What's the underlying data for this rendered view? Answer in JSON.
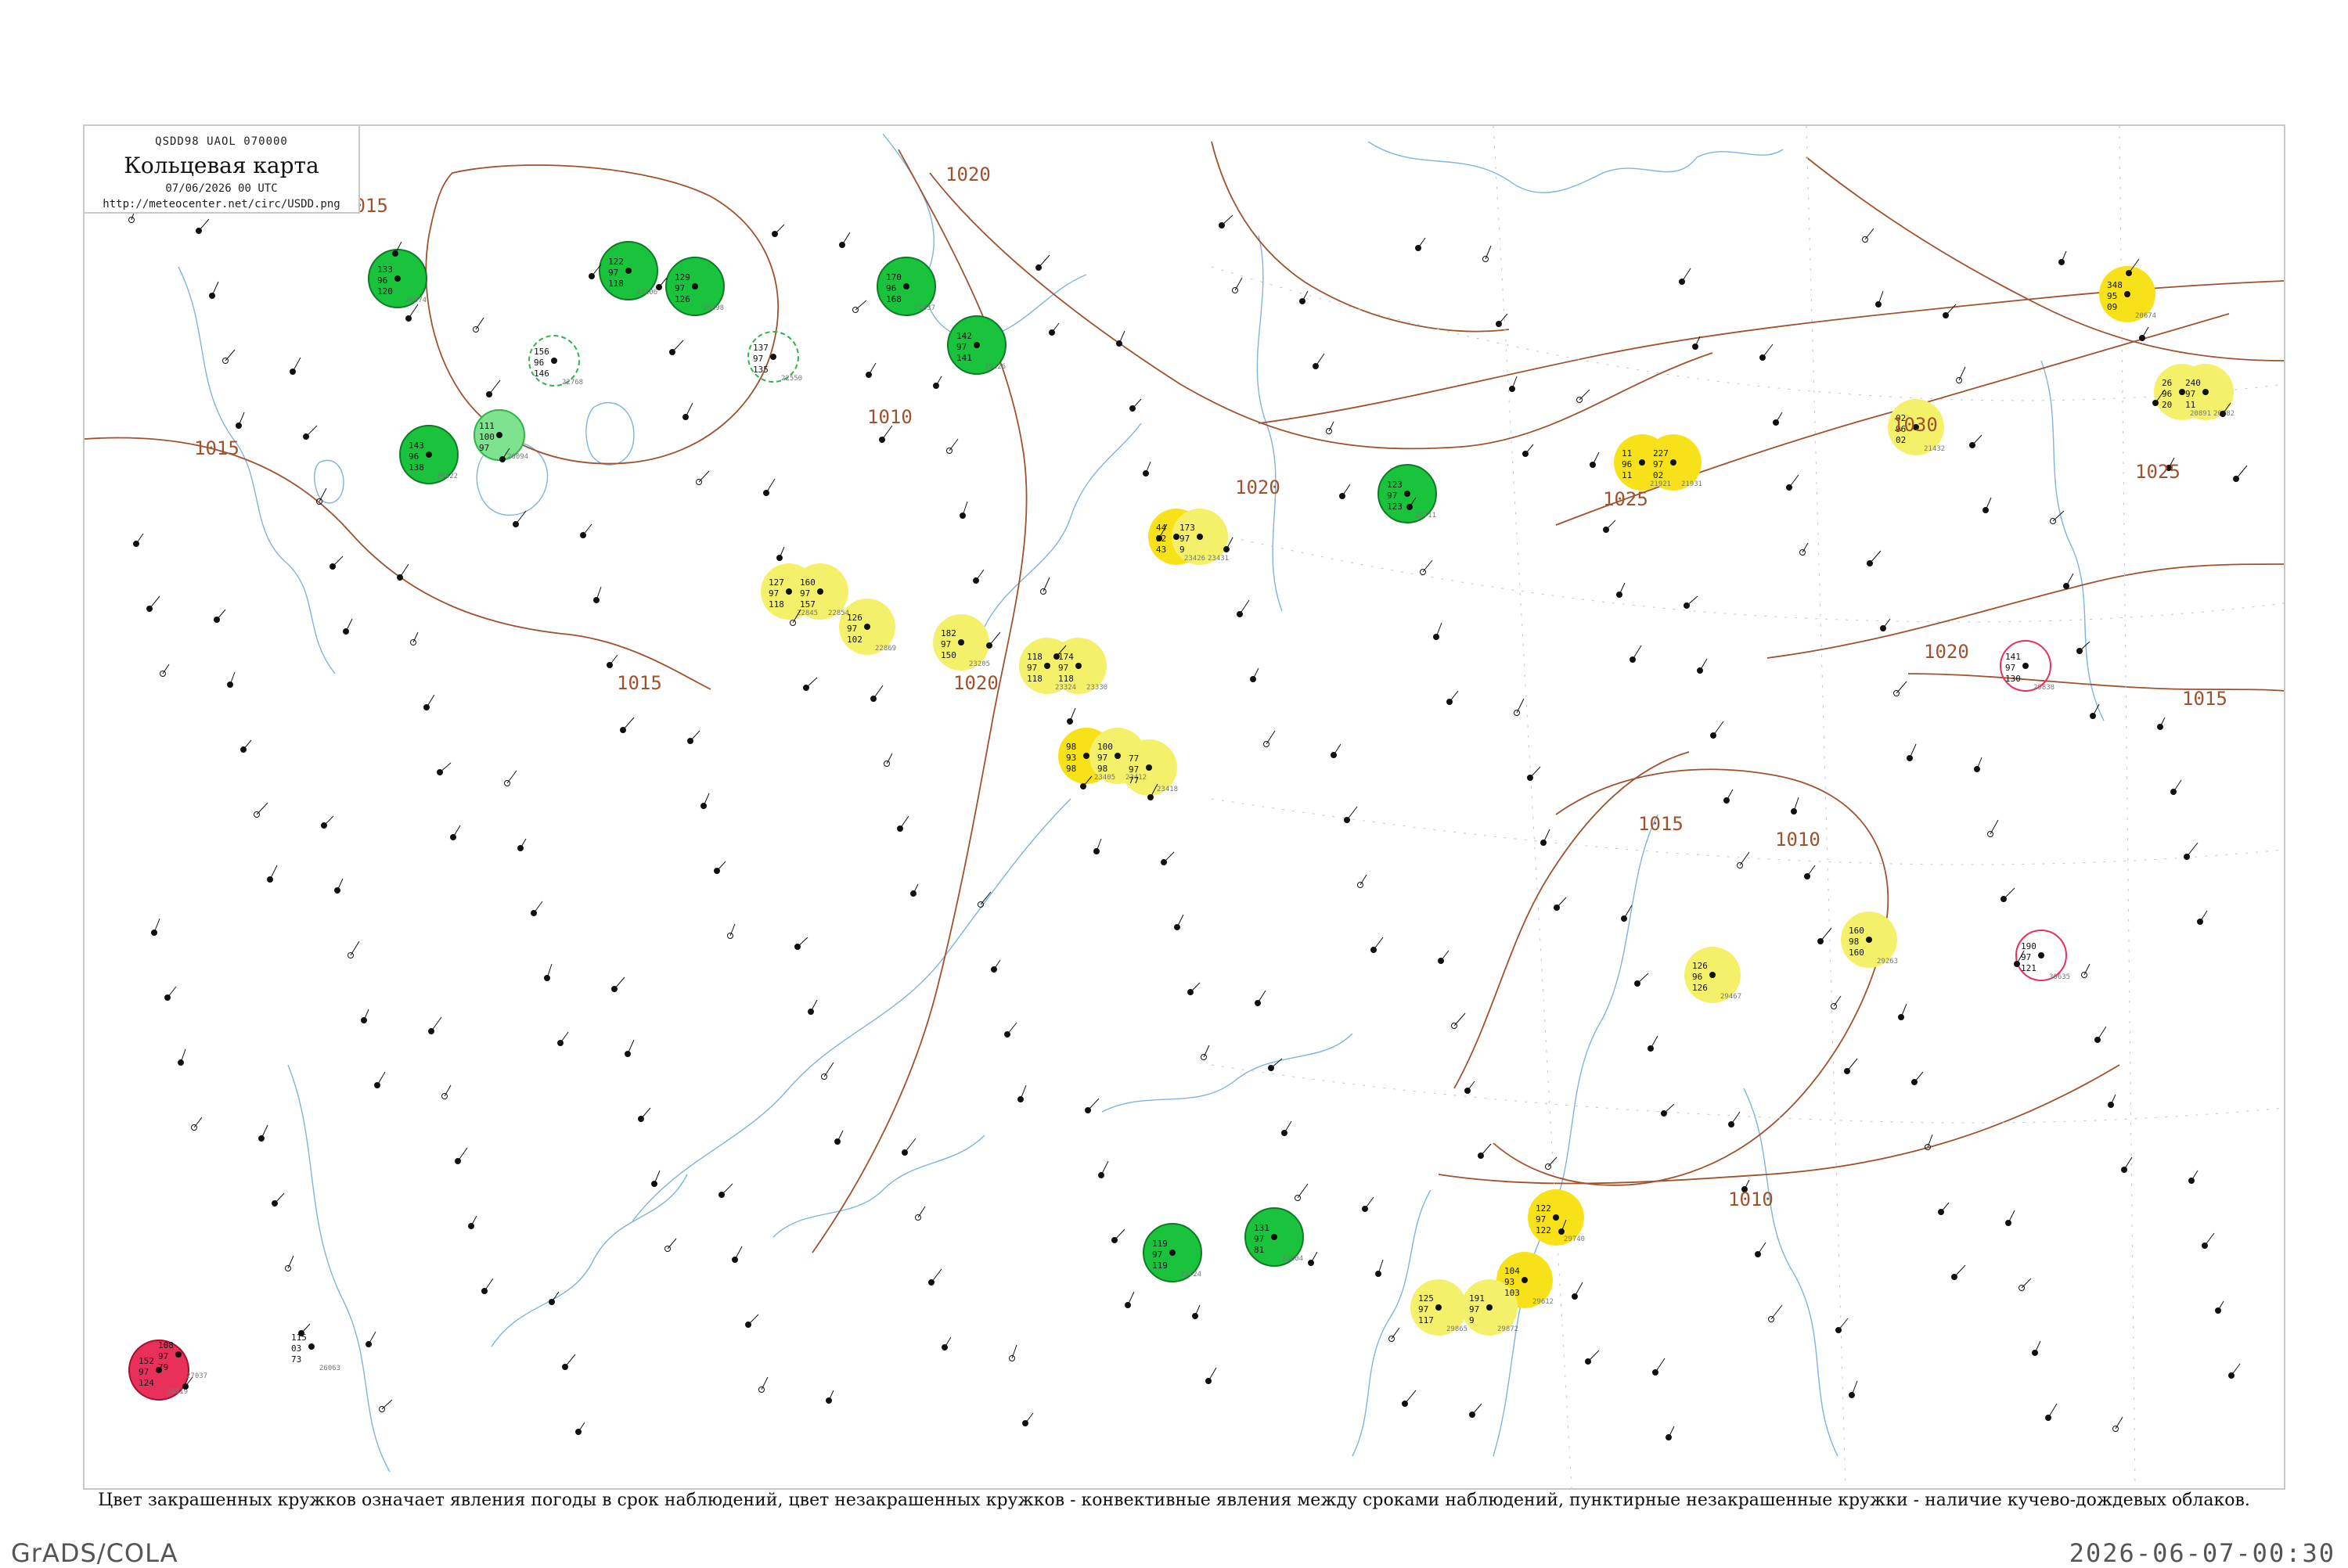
{
  "header": {
    "code": "QSDD98  UAOL  070000",
    "title": "Кольцевая карта",
    "date": "07/06/2026 00 UTC",
    "url": "http://meteocenter.net/circ/USDD.png"
  },
  "caption": "Цвет закрашенных кружков означает явления погоды в срок наблюдений, цвет незакрашенных кружков - конвективные явления между сроками наблюдений, пунктирные незакрашенные кружки - наличие кучево-дождевых облаков.",
  "footer": {
    "left": "GrADS/COLA",
    "right": "2026-06-07-00:30"
  },
  "colors": {
    "rain": "#19c43c",
    "drizzle": "#7ee38f",
    "shower_ring": "#2fb34a",
    "haze": "#f5f06a",
    "haze_strong": "#f7e21a",
    "thunder": "#e8305a",
    "isobar": "#a0522d",
    "river": "#7fb3e0",
    "border": "#c8c8c8"
  },
  "isobar_labels": [
    "1015",
    "1015",
    "1020",
    "1020",
    "1020",
    "1020",
    "1025",
    "1030",
    "1025",
    "1015",
    "1015",
    "1010",
    "1010",
    "1010",
    "1015"
  ],
  "stations": [
    {
      "t": "108",
      "p": "97",
      "d": "79",
      "id": "27037",
      "mark": "none"
    },
    {
      "t": "115",
      "p": "03",
      "d": "73",
      "id": "26063",
      "mark": "none"
    },
    {
      "t": "133",
      "p": "96",
      "d": "120",
      "id": "26074",
      "mark": "rain"
    },
    {
      "t": "111",
      "p": "100",
      "d": "97",
      "id": "26094",
      "mark": "drizzle"
    },
    {
      "t": "122",
      "p": "97",
      "d": "118",
      "id": "27106",
      "mark": "rain"
    },
    {
      "t": "129",
      "p": "97",
      "d": "126",
      "id": "26298",
      "mark": "rain"
    },
    {
      "t": "143",
      "p": "96",
      "d": "138",
      "id": "26422",
      "mark": "rain"
    },
    {
      "t": "137",
      "p": "97",
      "d": "135",
      "id": "22550",
      "mark": "ring"
    },
    {
      "t": "156",
      "p": "96",
      "d": "146",
      "id": "22768",
      "mark": "ring"
    },
    {
      "t": "170",
      "p": "96",
      "d": "168",
      "id": "22837",
      "mark": "rain"
    },
    {
      "t": "127",
      "p": "97",
      "d": "118",
      "id": "22845",
      "mark": "haze"
    },
    {
      "t": "160",
      "p": "97",
      "d": "157",
      "id": "22854",
      "mark": "haze"
    },
    {
      "t": "126",
      "p": "97",
      "d": "102",
      "id": "22869",
      "mark": "haze"
    },
    {
      "t": "182",
      "p": "97",
      "d": "150",
      "id": "23205",
      "mark": "haze"
    },
    {
      "t": "142",
      "p": "97",
      "d": "141",
      "id": "23226",
      "mark": "rain"
    },
    {
      "t": "118",
      "p": "97",
      "d": "118",
      "id": "23324",
      "mark": "haze"
    },
    {
      "t": "174",
      "p": "97",
      "d": "118",
      "id": "23330",
      "mark": "haze"
    },
    {
      "t": "98",
      "p": "93",
      "d": "98",
      "id": "23405",
      "mark": "haze_strong"
    },
    {
      "t": "100",
      "p": "97",
      "d": "98",
      "id": "23412",
      "mark": "haze"
    },
    {
      "t": "77",
      "p": "97",
      "d": "77",
      "id": "23418",
      "mark": "haze"
    },
    {
      "t": "44",
      "p": "92",
      "d": "43",
      "id": "23426",
      "mark": "haze_strong"
    },
    {
      "t": "173",
      "p": "97",
      "d": "9",
      "id": "23431",
      "mark": "haze"
    },
    {
      "t": "119",
      "p": "97",
      "d": "119",
      "id": "23724",
      "mark": "rain"
    },
    {
      "t": "131",
      "p": "97",
      "d": "81",
      "id": "23804",
      "mark": "rain"
    },
    {
      "t": "123",
      "p": "97",
      "d": "123",
      "id": "23711",
      "mark": "rain"
    },
    {
      "t": "348",
      "p": "95",
      "d": "09",
      "id": "20674",
      "mark": "haze_strong"
    },
    {
      "t": "26",
      "p": "96",
      "d": "20",
      "id": "20891",
      "mark": "haze"
    },
    {
      "t": "240",
      "p": "97",
      "d": "11",
      "id": "20982",
      "mark": "haze"
    },
    {
      "t": "02",
      "p": "96",
      "d": "02",
      "id": "21432",
      "mark": "haze"
    },
    {
      "t": "11",
      "p": "96",
      "d": "11",
      "id": "21921",
      "mark": "haze_strong"
    },
    {
      "t": "227",
      "p": "97",
      "d": "02",
      "id": "21931",
      "mark": "haze_strong"
    },
    {
      "t": "190",
      "p": "97",
      "d": "121",
      "id": "30635",
      "mark": "thunder_ring"
    },
    {
      "t": "141",
      "p": "97",
      "d": "130",
      "id": "29838",
      "mark": "thunder_ring"
    },
    {
      "t": "152",
      "p": "97",
      "d": "124",
      "id": "34519",
      "mark": "thunder"
    },
    {
      "t": "160",
      "p": "98",
      "d": "160",
      "id": "29263",
      "mark": "haze"
    },
    {
      "t": "126",
      "p": "96",
      "d": "126",
      "id": "29467",
      "mark": "haze"
    },
    {
      "t": "104",
      "p": "93",
      "d": "103",
      "id": "29612",
      "mark": "haze_strong"
    },
    {
      "t": "122",
      "p": "97",
      "d": "122",
      "id": "29740",
      "mark": "haze_strong"
    },
    {
      "t": "125",
      "p": "97",
      "d": "117",
      "id": "29865",
      "mark": "haze"
    },
    {
      "t": "191",
      "p": "97",
      "d": "9",
      "id": "29872",
      "mark": "haze"
    }
  ]
}
